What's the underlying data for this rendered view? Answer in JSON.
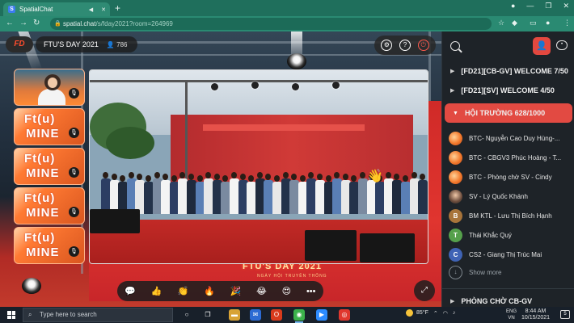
{
  "browser": {
    "tab_title": "SpatialChat",
    "new_tab": "+",
    "url_host": "spatial.chat",
    "url_path": "/s/fday2021?room=264969",
    "window_controls": [
      "●",
      "—",
      "❐",
      "✕"
    ]
  },
  "room_header": {
    "logo": "FD",
    "room_name": "FTU'S DAY 2021",
    "participant_count": "786"
  },
  "stage": {
    "banner_title": "FTU'S DAY 2021",
    "banner_sub": "NGÀY HỘI TRUYỀN THỐNG"
  },
  "participant_tiles": [
    {
      "line1": "",
      "line2": "",
      "is_video": true
    },
    {
      "line1": "Ft(u)",
      "line2": "MINE"
    },
    {
      "line1": "Ft(u)",
      "line2": "MINE"
    },
    {
      "line1": "Ft(u)",
      "line2": "MINE"
    },
    {
      "line1": "Ft(u)",
      "line2": "MINE"
    }
  ],
  "reactions": [
    "💬",
    "👍",
    "👏",
    "🔥",
    "🎉",
    "😂",
    "😍",
    "•••"
  ],
  "sidebar": {
    "rooms": [
      {
        "name": "[FD21][CB-GV] WELCOME 7/50"
      },
      {
        "name": "[FD21][SV] WELCOME 4/50"
      },
      {
        "name": "HỘI TRƯỜNG 628/1000",
        "active": true
      }
    ],
    "members": [
      {
        "avatar": "",
        "type": "img",
        "name": "BTC- Nguyễn Cao Duy Hùng-..."
      },
      {
        "avatar": "",
        "type": "img",
        "name": "BTC - CBGV3 Phúc Hoàng - T..."
      },
      {
        "avatar": "",
        "type": "img",
        "name": "BTC - Phòng chờ SV - Cindy"
      },
      {
        "avatar": "",
        "type": "photo",
        "name": "SV - Lý Quốc Khánh"
      },
      {
        "avatar": "B",
        "color": "#a8743a",
        "name": "BM KTL - Lưu Thị Bích Hạnh"
      },
      {
        "avatar": "T",
        "color": "#55a04b",
        "name": "Thái Khắc Quý"
      },
      {
        "avatar": "C",
        "color": "#3f63b5",
        "name": "CS2 - Giang Thị Trúc Mai"
      }
    ],
    "show_more": "Show more",
    "next_room": "PHÒNG CHỜ CB-GV"
  },
  "taskbar": {
    "search_placeholder": "Type here to search",
    "weather": "85°F",
    "lang_top": "ENG",
    "lang_bottom": "VN",
    "time": "8:44 AM",
    "date": "10/15/2021",
    "notifications": "5"
  }
}
